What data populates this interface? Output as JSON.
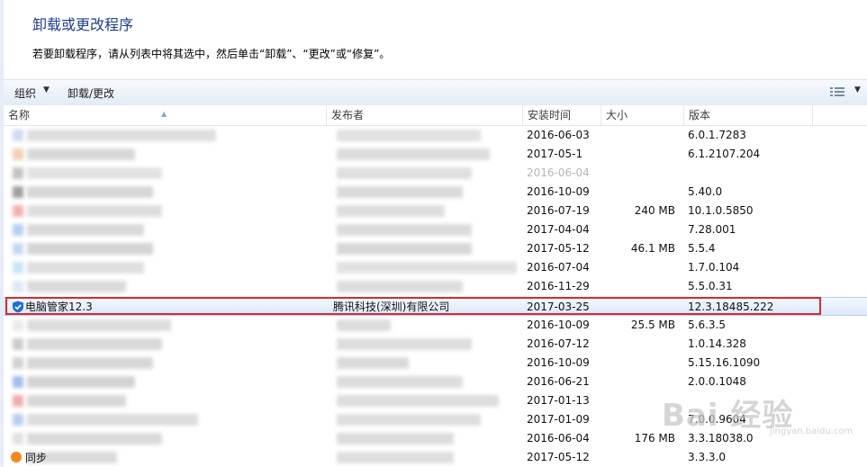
{
  "page": {
    "title": "卸载或更改程序",
    "description": "若要卸载程序，请从列表中将其选中，然后单击“卸载”、“更改”或“修复”。"
  },
  "toolbar": {
    "organize_label": "组织",
    "uninstall_change_label": "卸载/更改"
  },
  "columns": {
    "name": "名称",
    "publisher": "发布者",
    "installed_on": "安装时间",
    "size": "大小",
    "version": "版本"
  },
  "rows": [
    {
      "date": "2016-06-03",
      "size": "",
      "version": "6.0.1.7283"
    },
    {
      "date": "2017-05-1",
      "size": "",
      "version": "6.1.2107.204"
    },
    {
      "date": "2016-06-04",
      "size": "",
      "version": ""
    },
    {
      "date": "2016-10-09",
      "size": "",
      "version": "5.40.0"
    },
    {
      "date": "2016-07-19",
      "size": "240 MB",
      "version": "10.1.0.5850"
    },
    {
      "date": "2017-04-04",
      "size": "",
      "version": "7.28.001"
    },
    {
      "date": "2017-05-12",
      "size": "46.1 MB",
      "version": "5.5.4"
    },
    {
      "date": "2016-07-04",
      "size": "",
      "version": "1.7.0.104"
    },
    {
      "date": "2016-11-29",
      "size": "",
      "version": "5.5.0.31"
    },
    {
      "name": "电脑管家12.3",
      "publisher": "腾讯科技(深圳)有限公司",
      "date": "2017-03-25",
      "size": "",
      "version": "12.3.18485.222",
      "selected": true
    },
    {
      "date": "2016-10-09",
      "size": "25.5 MB",
      "version": "5.6.3.5"
    },
    {
      "date": "2016-07-12",
      "size": "",
      "version": "1.0.14.328"
    },
    {
      "date": "2016-10-09",
      "size": "",
      "version": "5.15.16.1090"
    },
    {
      "date": "2016-06-21",
      "size": "",
      "version": "2.0.0.1048"
    },
    {
      "date": "2017-01-13",
      "size": "",
      "version": ""
    },
    {
      "date": "2017-01-09",
      "size": "",
      "version": "7.0.0.9604"
    },
    {
      "date": "2016-06-04",
      "size": "176 MB",
      "version": "3.3.18038.0"
    },
    {
      "date": "2017-05-12",
      "size": "",
      "version": "3.3.3.0"
    }
  ],
  "bottom_partial_name": "同步",
  "watermark": {
    "main": "Bai 经验",
    "sub": "jingyan.baidu.com"
  },
  "colors": {
    "title": "#1e3d8f",
    "highlight_box": "#e0262e",
    "selection": "#dbe9f9"
  }
}
